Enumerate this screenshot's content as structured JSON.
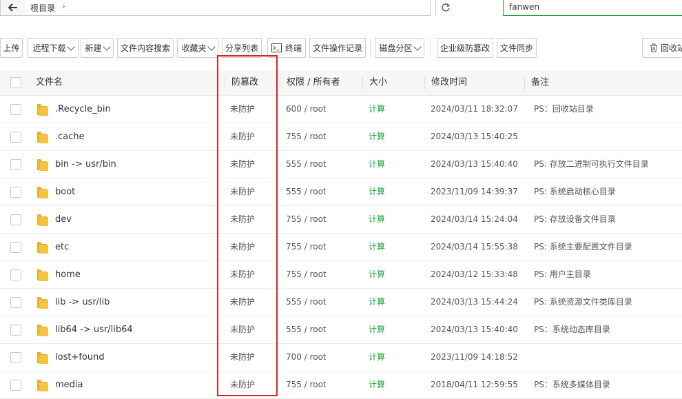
{
  "pathbar": {
    "breadcrumb_root": "根目录",
    "search_value": "fanwen"
  },
  "toolbar": {
    "buttons": [
      {
        "label": "上传"
      },
      {
        "label": "远程下载"
      },
      {
        "label": "新建"
      },
      {
        "label": "文件内容搜索"
      },
      {
        "label": "收藏夹"
      },
      {
        "label": "分享列表"
      },
      {
        "label": "终端"
      },
      {
        "label": "文件操作记录"
      },
      {
        "label": "磁盘分区"
      },
      {
        "label": "企业级防篡改"
      },
      {
        "label": "文件同步"
      },
      {
        "label": "回收站"
      }
    ]
  },
  "table": {
    "headers": {
      "name": "文件名",
      "protect": "防篡改",
      "perm": "权限 / 所有者",
      "size": "大小",
      "mtime": "修改时间",
      "note": "备注"
    },
    "rows": [
      {
        "name": ".Recycle_bin",
        "protect": "未防护",
        "perm": "600 / root",
        "size": "计算",
        "mtime": "2024/03/11 18:32:07",
        "note": "PS：回收站目录"
      },
      {
        "name": ".cache",
        "protect": "未防护",
        "perm": "755 / root",
        "size": "计算",
        "mtime": "2024/03/13 15:40:25",
        "note": ""
      },
      {
        "name": "bin -> usr/bin",
        "protect": "未防护",
        "perm": "555 / root",
        "size": "计算",
        "mtime": "2024/03/13 15:40:40",
        "note": "PS: 存放二进制可执行文件目录"
      },
      {
        "name": "boot",
        "protect": "未防护",
        "perm": "555 / root",
        "size": "计算",
        "mtime": "2023/11/09 14:39:37",
        "note": "PS: 系统启动核心目录"
      },
      {
        "name": "dev",
        "protect": "未防护",
        "perm": "755 / root",
        "size": "计算",
        "mtime": "2024/03/14 15:24:04",
        "note": "PS: 存放设备文件目录"
      },
      {
        "name": "etc",
        "protect": "未防护",
        "perm": "755 / root",
        "size": "计算",
        "mtime": "2024/03/14 15:55:38",
        "note": "PS: 系统主要配置文件目录"
      },
      {
        "name": "home",
        "protect": "未防护",
        "perm": "755 / root",
        "size": "计算",
        "mtime": "2024/03/12 15:33:48",
        "note": "PS: 用户主目录"
      },
      {
        "name": "lib -> usr/lib",
        "protect": "未防护",
        "perm": "555 / root",
        "size": "计算",
        "mtime": "2024/03/13 15:44:24",
        "note": "PS: 系统资源文件类库目录"
      },
      {
        "name": "lib64 -> usr/lib64",
        "protect": "未防护",
        "perm": "555 / root",
        "size": "计算",
        "mtime": "2024/03/13 15:40:40",
        "note": "PS：系统动态库目录"
      },
      {
        "name": "lost+found",
        "protect": "未防护",
        "perm": "700 / root",
        "size": "计算",
        "mtime": "2023/11/09 14:18:52",
        "note": ""
      },
      {
        "name": "media",
        "protect": "未防护",
        "perm": "755 / root",
        "size": "计算",
        "mtime": "2018/04/11 12:59:55",
        "note": "PS：系统多媒体目录"
      }
    ]
  },
  "colors": {
    "accent_green": "#20a53a",
    "highlight_red": "#e02020",
    "folder_yellow": "#f5c342"
  }
}
